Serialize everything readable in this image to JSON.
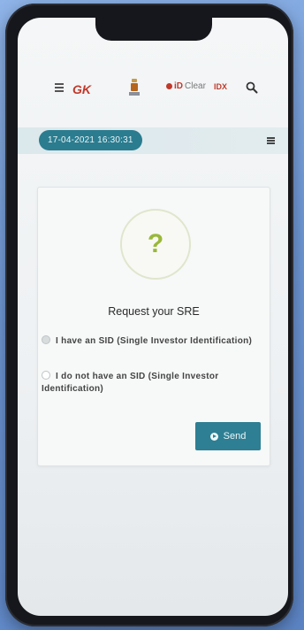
{
  "header": {
    "gk_logo": "GK",
    "idclear_logo": {
      "prefix": "iD",
      "suffix": "Clear"
    },
    "idx_logo": "IDX"
  },
  "date_bar": {
    "datetime": "17-04-2021 16:30:31"
  },
  "card": {
    "title": "Request your SRE",
    "options": [
      {
        "label": "I have an SID (Single Investor Identification)",
        "selected": true
      },
      {
        "label": "I do not have an SID (Single Investor Identification)",
        "selected": false
      }
    ],
    "send_label": "Send"
  },
  "colors": {
    "accent": "#2e7f93",
    "question_mark": "#9ab83a",
    "brand_red": "#c0392b"
  },
  "icons": [
    "menu-icon",
    "search-icon",
    "question-icon",
    "send-icon"
  ]
}
